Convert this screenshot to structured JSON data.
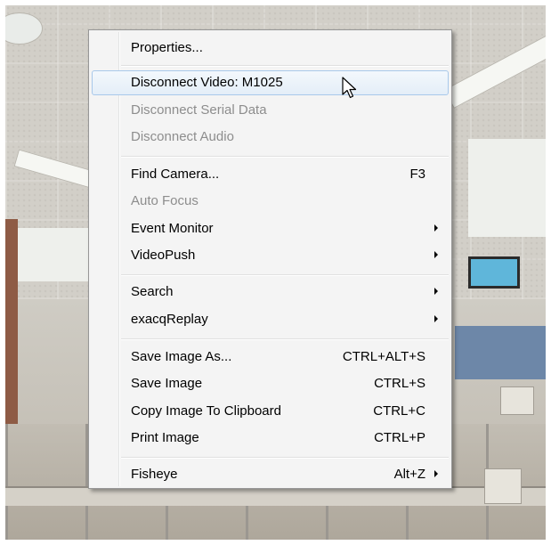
{
  "menu": {
    "items": [
      {
        "label": "Properties..."
      },
      {
        "label": "Disconnect Video: M1025"
      },
      {
        "label": "Disconnect Serial Data"
      },
      {
        "label": "Disconnect Audio"
      },
      {
        "label": "Find Camera...",
        "shortcut": "F3"
      },
      {
        "label": "Auto Focus"
      },
      {
        "label": "Event Monitor"
      },
      {
        "label": "VideoPush"
      },
      {
        "label": "Search"
      },
      {
        "label": "exacqReplay"
      },
      {
        "label": "Save Image As...",
        "shortcut": "CTRL+ALT+S"
      },
      {
        "label": "Save Image",
        "shortcut": "CTRL+S"
      },
      {
        "label": "Copy Image To Clipboard",
        "shortcut": "CTRL+C"
      },
      {
        "label": "Print Image",
        "shortcut": "CTRL+P"
      },
      {
        "label": "Fisheye",
        "shortcut": "Alt+Z"
      }
    ],
    "disabled_items": [
      "Disconnect Serial Data",
      "Disconnect Audio",
      "Auto Focus"
    ],
    "highlighted_item": "Disconnect Video: M1025",
    "submenu_icon": "chevron-right-icon",
    "colors": {
      "highlight_border": "#a8c8ea",
      "highlight_fill": "#e4eef8",
      "disabled_text": "#8d8d8d",
      "menu_background": "#f4f4f4"
    }
  },
  "cursor": {
    "icon": "mouse-pointer-icon"
  }
}
